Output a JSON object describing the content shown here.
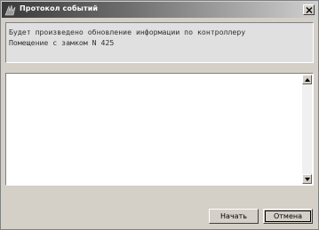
{
  "window": {
    "title": "Протокол событий",
    "close_glyph": "×"
  },
  "message": {
    "line1": "Будет произведено обновление информации по контроллеру",
    "line2": "Помещение с замком N 425"
  },
  "log": {
    "content": ""
  },
  "buttons": {
    "start_label": "Начать",
    "cancel_label": "Отмена"
  },
  "icons": {
    "app": "wing-logo-icon",
    "close": "close-icon",
    "scroll_up": "arrow-up-icon",
    "scroll_down": "arrow-down-icon"
  }
}
